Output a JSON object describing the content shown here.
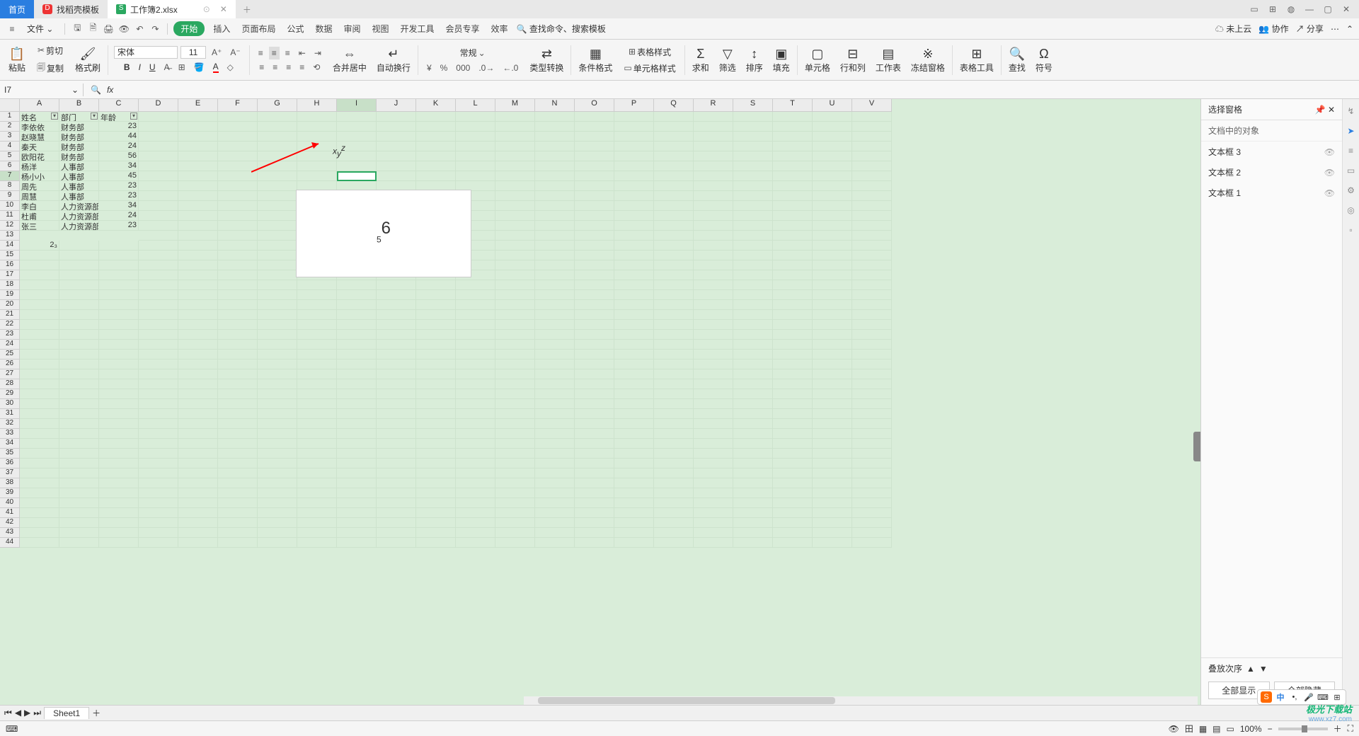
{
  "tabs": {
    "home": "首页",
    "template": "找稻壳模板",
    "doc": "工作簿2.xlsx"
  },
  "menubar": {
    "file": "文件",
    "start": "开始",
    "items": [
      "插入",
      "页面布局",
      "公式",
      "数据",
      "审阅",
      "视图",
      "开发工具",
      "会员专享",
      "效率"
    ],
    "search_placeholder": "查找命令、搜索模板",
    "cloud": "未上云",
    "collab": "协作",
    "share": "分享"
  },
  "ribbon": {
    "paste": "粘贴",
    "cut": "剪切",
    "copy": "复制",
    "format_paint": "格式刷",
    "font_name": "宋体",
    "font_size": "11",
    "merge": "合并居中",
    "wrap": "自动换行",
    "number_fmt": "常规",
    "type_conv": "类型转换",
    "cond": "条件格式",
    "table_style": "表格样式",
    "cell_style": "单元格样式",
    "sum": "求和",
    "filter": "筛选",
    "sort": "排序",
    "fill": "填充",
    "cell": "单元格",
    "rowcol": "行和列",
    "sheet": "工作表",
    "freeze": "冻结窗格",
    "table_tool": "表格工具",
    "find": "查找",
    "symbol": "符号"
  },
  "namebox": "I7",
  "fx": "fx",
  "columns": [
    "A",
    "B",
    "C",
    "D",
    "E",
    "F",
    "G",
    "H",
    "I",
    "J",
    "K",
    "L",
    "M",
    "N",
    "O",
    "P",
    "Q",
    "R",
    "S",
    "T",
    "U",
    "V"
  ],
  "row_count": 44,
  "table": {
    "headers": [
      "姓名",
      "部门",
      "年龄"
    ],
    "rows": [
      [
        "李依依",
        "财务部",
        "23"
      ],
      [
        "赵晓慧",
        "财务部",
        "44"
      ],
      [
        "秦天",
        "财务部",
        "24"
      ],
      [
        "欧阳花",
        "财务部",
        "56"
      ],
      [
        "杨洋",
        "人事部",
        "34"
      ],
      [
        "杨小小",
        "人事部",
        "45"
      ],
      [
        "周先",
        "人事部",
        "23"
      ],
      [
        "周慧",
        "人事部",
        "23"
      ],
      [
        "李白",
        "人力资源部",
        "34"
      ],
      [
        "杜甫",
        "人力资源部",
        "24"
      ],
      [
        "张三",
        "人力资源部",
        "23"
      ]
    ],
    "a14": "2₃"
  },
  "textbox_small": "x",
  "textbox_small_sub": "y",
  "textbox_small_sup": "z",
  "textbox_big": "5",
  "textbox_big_sup": "6",
  "panel": {
    "title": "选择窗格",
    "section": "文档中的对象",
    "items": [
      "文本框 3",
      "文本框 2",
      "文本框 1"
    ],
    "order": "叠放次序",
    "show_all": "全部显示",
    "hide_all": "全部隐藏"
  },
  "sheet": {
    "name": "Sheet1"
  },
  "status": {
    "zoom": "100%"
  },
  "ime": {
    "logo": "S",
    "lang": "中"
  },
  "watermark": {
    "l1": "极光下载站",
    "l2": "www.xz7.com"
  }
}
